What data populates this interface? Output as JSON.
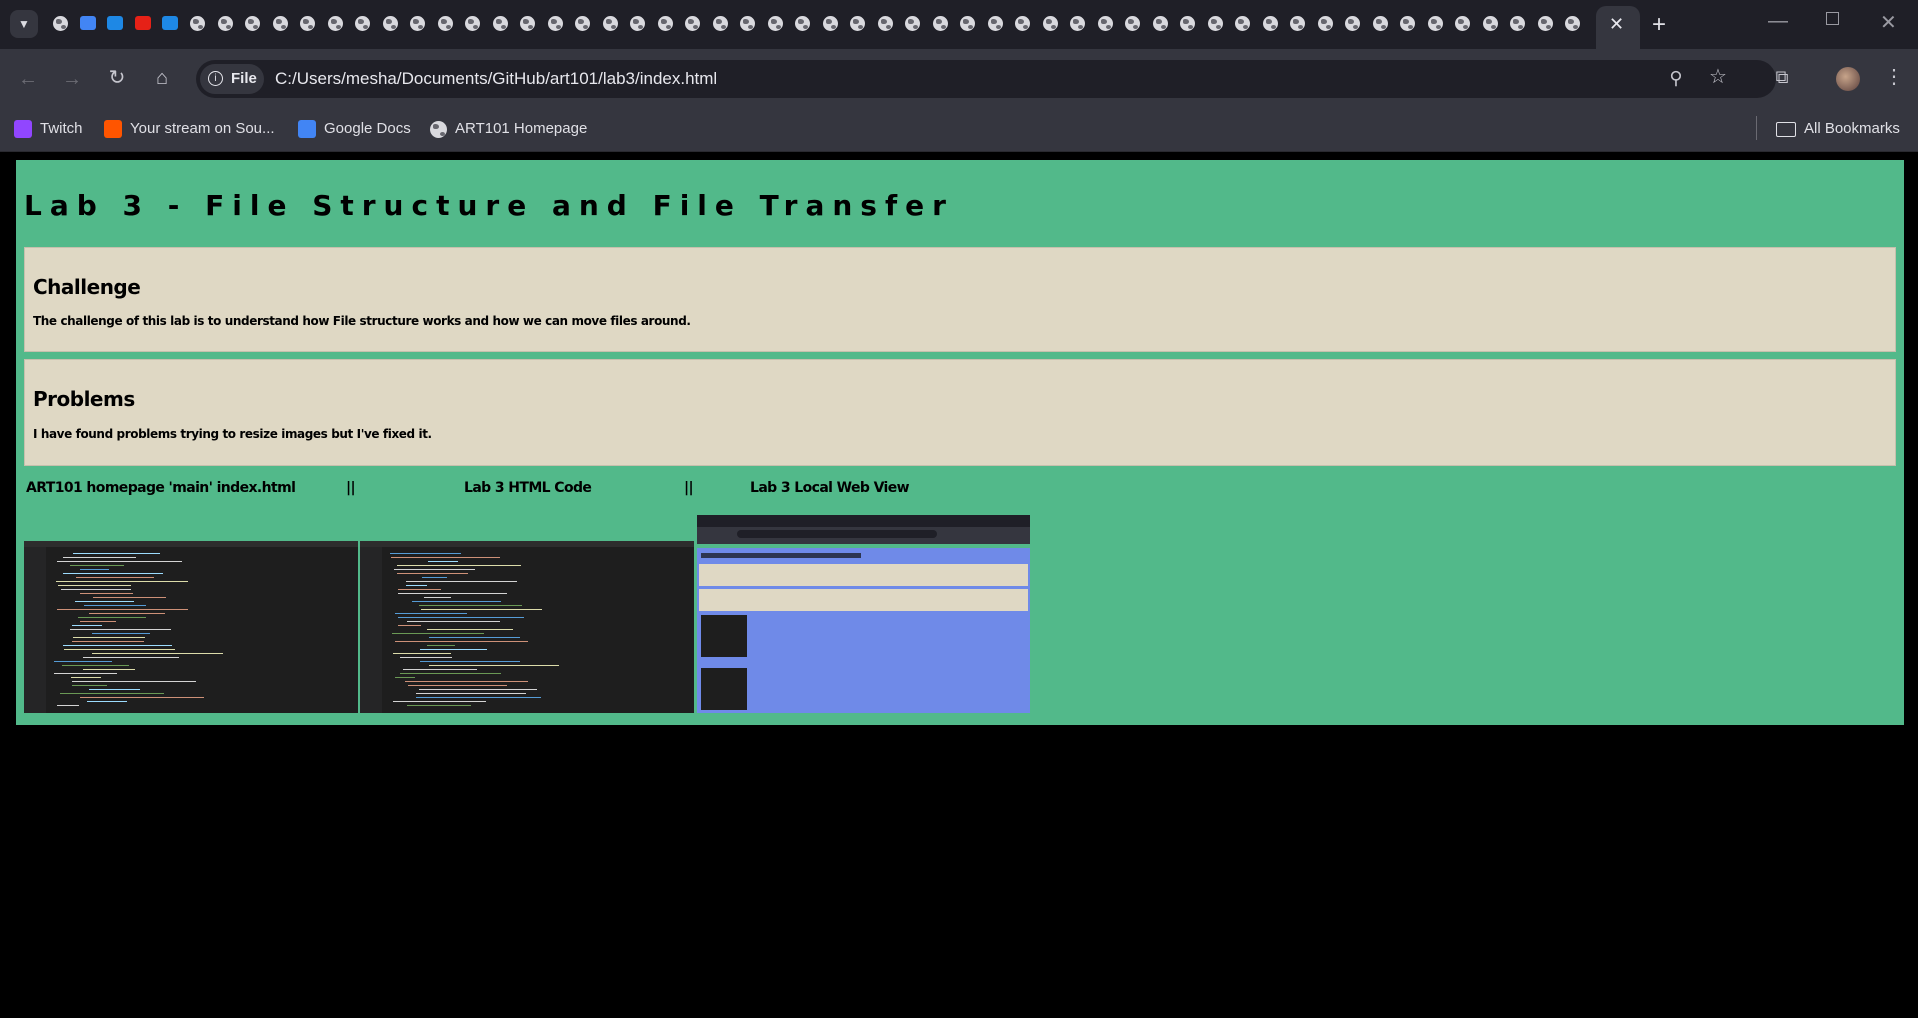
{
  "browser": {
    "address": {
      "chip_label": "File",
      "url": "C:/Users/mesha/Documents/GitHub/art101/lab3/index.html"
    },
    "bookmarks": [
      {
        "label": "Twitch",
        "icon": "twitch-icon",
        "color": "#9146ff"
      },
      {
        "label": "Your stream on Sou...",
        "icon": "soundcloud-icon",
        "color": "#ff5500"
      },
      {
        "label": "Google Docs",
        "icon": "google-docs-icon",
        "color": "#4285f4"
      },
      {
        "label": "ART101 Homepage",
        "icon": "globe-icon",
        "color": "#bdbdc4"
      }
    ],
    "all_bookmarks_label": "All Bookmarks"
  },
  "page": {
    "title": "Lab 3 - File Structure and File Transfer",
    "challenge": {
      "heading": "Challenge",
      "text": "The challenge of this lab is to understand how File structure works and how we can move files around."
    },
    "problems": {
      "heading": "Problems",
      "text": "I have found problems trying to resize images but I've fixed it."
    },
    "image_labels": {
      "first": "ART101 homepage 'main' index.html",
      "separator": "||",
      "second": "Lab 3 HTML Code",
      "third": "Lab 3 Local Web View"
    },
    "colors": {
      "page_bg": "#52b98a",
      "box_bg": "#dfd8c4",
      "webview_bg": "#6f8ae8"
    }
  }
}
